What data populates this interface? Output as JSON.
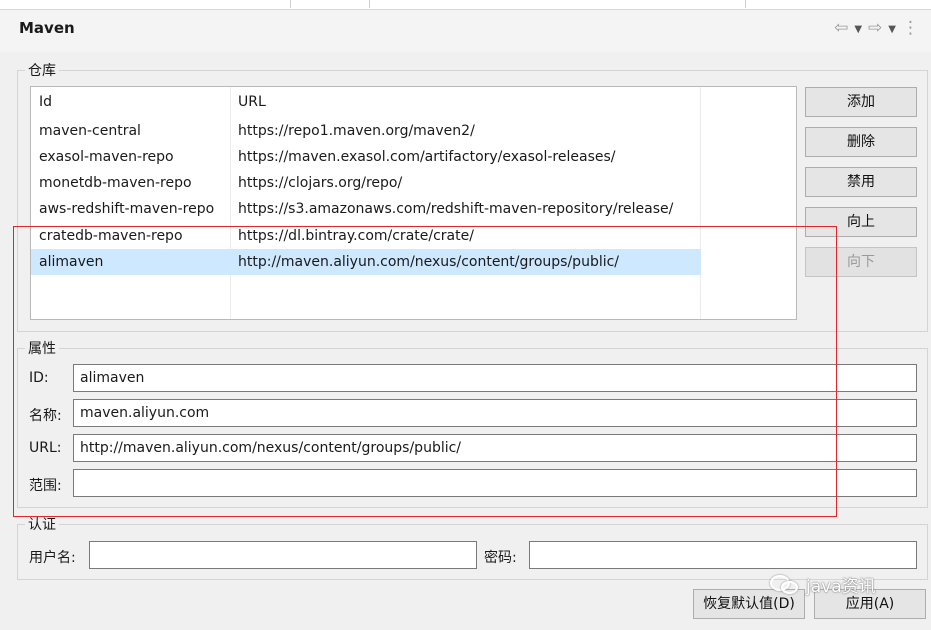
{
  "panel": {
    "title": "Maven",
    "nav_icons": [
      "back-arrow-icon",
      "dropdown-icon",
      "forward-arrow-icon",
      "dropdown-icon",
      "more-vertical-icon"
    ]
  },
  "repos": {
    "legend": "仓库",
    "columns": {
      "id": "Id",
      "url": "URL"
    },
    "rows": [
      {
        "id": "maven-central",
        "url": "https://repo1.maven.org/maven2/"
      },
      {
        "id": "exasol-maven-repo",
        "url": "https://maven.exasol.com/artifactory/exasol-releases/"
      },
      {
        "id": "monetdb-maven-repo",
        "url": "https://clojars.org/repo/"
      },
      {
        "id": "aws-redshift-maven-repo",
        "url": "https://s3.amazonaws.com/redshift-maven-repository/release/"
      },
      {
        "id": "cratedb-maven-repo",
        "url": "https://dl.bintray.com/crate/crate/"
      },
      {
        "id": "alimaven",
        "url": "http://maven.aliyun.com/nexus/content/groups/public/"
      }
    ],
    "selected_index": 5,
    "buttons": {
      "add": "添加",
      "delete": "删除",
      "disable": "禁用",
      "up": "向上",
      "down": "向下"
    }
  },
  "properties": {
    "legend": "属性",
    "id_label": "ID:",
    "id_value": "alimaven",
    "name_label": "名称:",
    "name_value": "maven.aliyun.com",
    "url_label": "URL:",
    "url_value": "http://maven.aliyun.com/nexus/content/groups/public/",
    "scope_label": "范围:",
    "scope_value": ""
  },
  "auth": {
    "legend": "认证",
    "username_label": "用户名:",
    "username_value": "",
    "password_label": "密码:",
    "password_value": ""
  },
  "footer": {
    "restore_label": "恢复默认值(D)",
    "apply_label": "应用(A)"
  },
  "watermark": {
    "text": "java资讯"
  },
  "colors": {
    "selection": "#cde8ff",
    "highlight_box": "#e0262b"
  }
}
